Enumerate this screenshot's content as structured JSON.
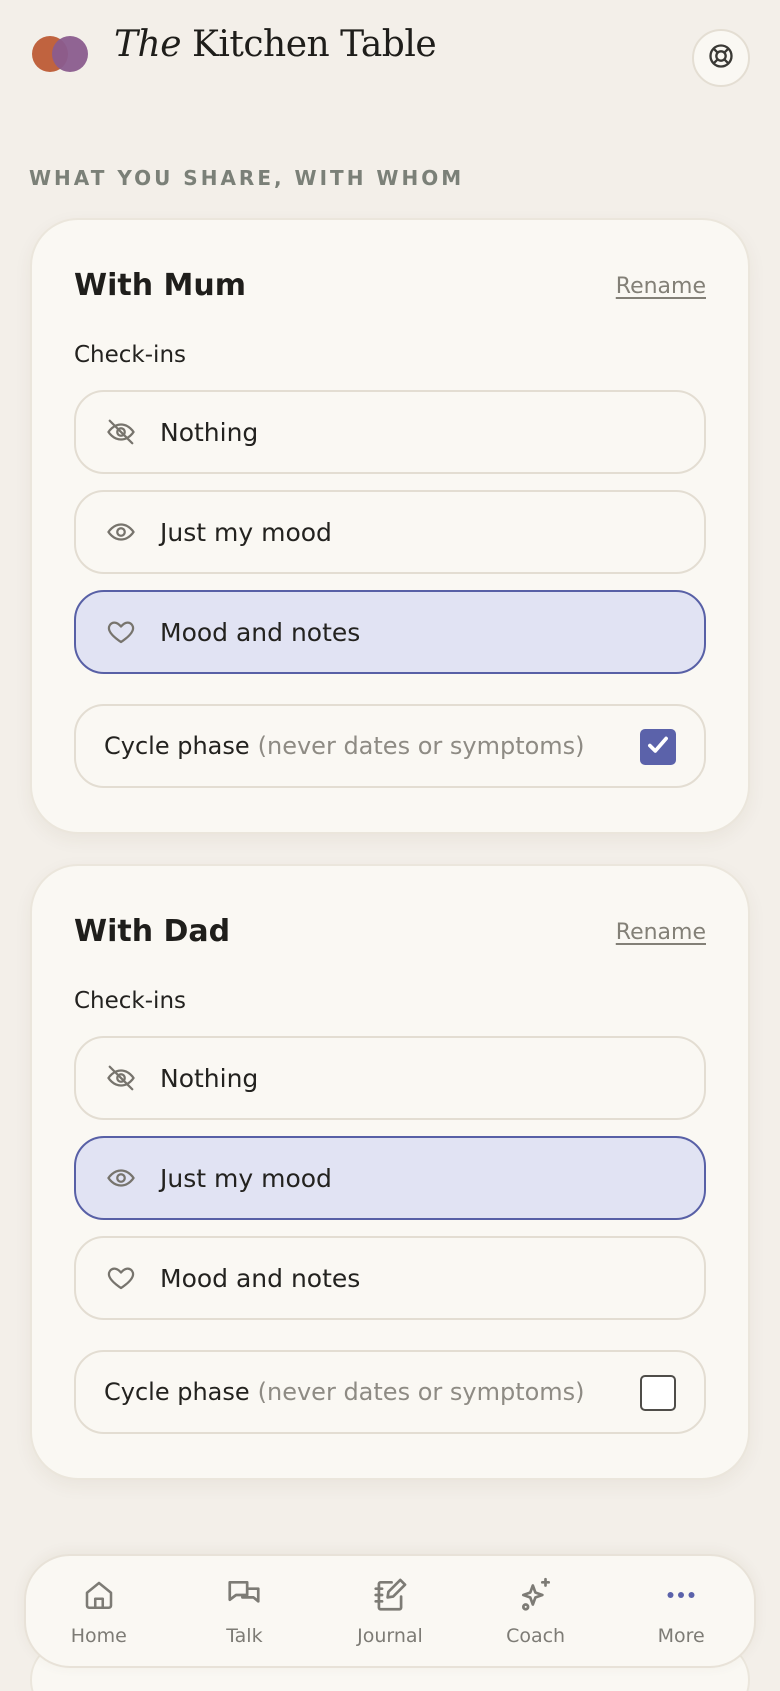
{
  "app": {
    "brand_italic": "The",
    "brand_rest": "Kitchen Table"
  },
  "section_label": "WHAT YOU SHARE, WITH WHOM",
  "colors": {
    "accent": "#5b62aa",
    "selected_bg": "#e1e3f3",
    "background": "#f3efe9",
    "card": "#faf8f3"
  },
  "cards": [
    {
      "title": "With Mum",
      "rename_label": "Rename",
      "subhead": "Check-ins",
      "options": [
        {
          "label": "Nothing",
          "icon": "eye-off-icon",
          "selected": false
        },
        {
          "label": "Just my mood",
          "icon": "eye-icon",
          "selected": false
        },
        {
          "label": "Mood and notes",
          "icon": "heart-icon",
          "selected": true
        }
      ],
      "cycle": {
        "label": "Cycle phase",
        "note": "(never dates or symptoms)",
        "checked": true
      }
    },
    {
      "title": "With Dad",
      "rename_label": "Rename",
      "subhead": "Check-ins",
      "options": [
        {
          "label": "Nothing",
          "icon": "eye-off-icon",
          "selected": false
        },
        {
          "label": "Just my mood",
          "icon": "eye-icon",
          "selected": true
        },
        {
          "label": "Mood and notes",
          "icon": "heart-icon",
          "selected": false
        }
      ],
      "cycle": {
        "label": "Cycle phase",
        "note": "(never dates or symptoms)",
        "checked": false
      }
    }
  ],
  "nav": [
    {
      "label": "Home",
      "icon": "home-icon"
    },
    {
      "label": "Talk",
      "icon": "chat-bubbles-icon"
    },
    {
      "label": "Journal",
      "icon": "notebook-pen-icon"
    },
    {
      "label": "Coach",
      "icon": "sparkles-icon"
    },
    {
      "label": "More",
      "icon": "more-dots-icon"
    }
  ]
}
